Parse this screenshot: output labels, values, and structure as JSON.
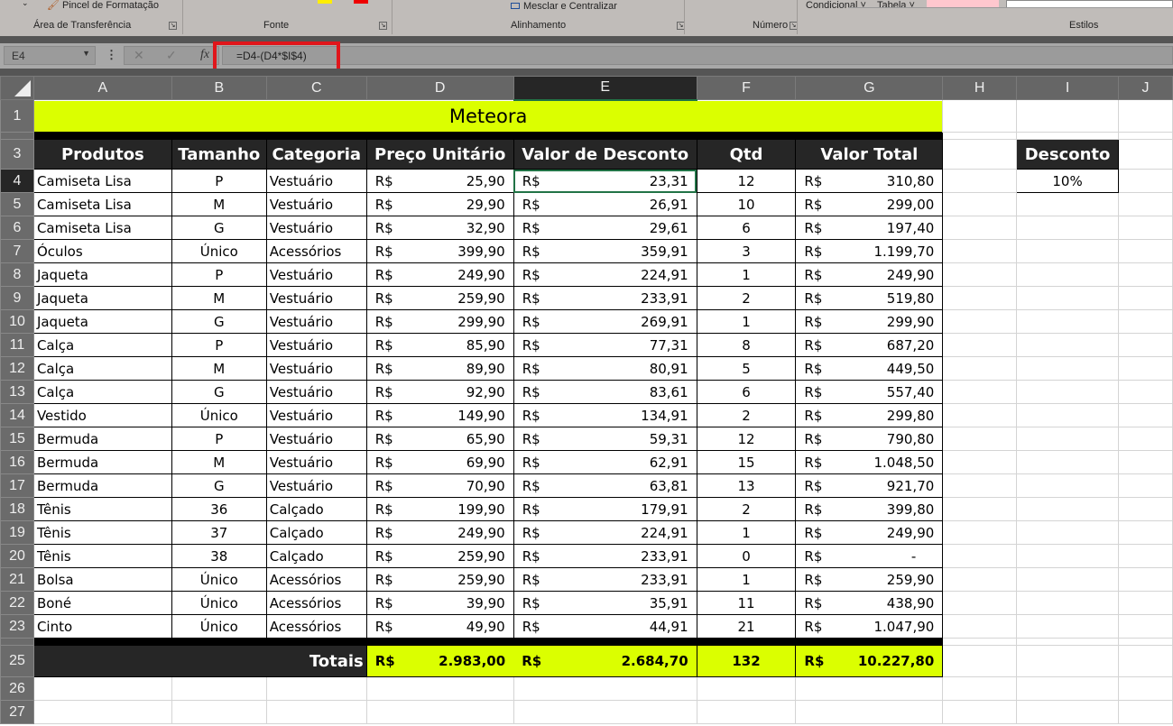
{
  "ribbon": {
    "clipboard_item": "Pincel de Formatação",
    "groups": [
      "Área de Transferência",
      "Fonte",
      "Alinhamento",
      "Número",
      "Estilos"
    ],
    "merge_label": "Mesclar e Centralizar",
    "conditional_label": "Condicional",
    "table_label": "Tabela"
  },
  "formula_bar": {
    "name_box": "E4",
    "formula": "=D4-(D4*$I$4)"
  },
  "columns": [
    "A",
    "B",
    "C",
    "D",
    "E",
    "F",
    "G",
    "H",
    "I",
    "J"
  ],
  "title": "Meteora",
  "headers": [
    "Produtos",
    "Tamanho",
    "Categoria",
    "Preço Unitário",
    "Valor de Desconto",
    "Qtd",
    "Valor Total"
  ],
  "currency": "R$",
  "rows": [
    [
      "Camiseta Lisa",
      "P",
      "Vestuário",
      "25,90",
      "23,31",
      "12",
      "310,80"
    ],
    [
      "Camiseta Lisa",
      "M",
      "Vestuário",
      "29,90",
      "26,91",
      "10",
      "299,00"
    ],
    [
      "Camiseta Lisa",
      "G",
      "Vestuário",
      "32,90",
      "29,61",
      "6",
      "197,40"
    ],
    [
      "Óculos",
      "Único",
      "Acessórios",
      "399,90",
      "359,91",
      "3",
      "1.199,70"
    ],
    [
      "Jaqueta",
      "P",
      "Vestuário",
      "249,90",
      "224,91",
      "1",
      "249,90"
    ],
    [
      "Jaqueta",
      "M",
      "Vestuário",
      "259,90",
      "233,91",
      "2",
      "519,80"
    ],
    [
      "Jaqueta",
      "G",
      "Vestuário",
      "299,90",
      "269,91",
      "1",
      "299,90"
    ],
    [
      "Calça",
      "P",
      "Vestuário",
      "85,90",
      "77,31",
      "8",
      "687,20"
    ],
    [
      "Calça",
      "M",
      "Vestuário",
      "89,90",
      "80,91",
      "5",
      "449,50"
    ],
    [
      "Calça",
      "G",
      "Vestuário",
      "92,90",
      "83,61",
      "6",
      "557,40"
    ],
    [
      "Vestido",
      "Único",
      "Vestuário",
      "149,90",
      "134,91",
      "2",
      "299,80"
    ],
    [
      "Bermuda",
      "P",
      "Vestuário",
      "65,90",
      "59,31",
      "12",
      "790,80"
    ],
    [
      "Bermuda",
      "M",
      "Vestuário",
      "69,90",
      "62,91",
      "15",
      "1.048,50"
    ],
    [
      "Bermuda",
      "G",
      "Vestuário",
      "70,90",
      "63,81",
      "13",
      "921,70"
    ],
    [
      "Tênis",
      "36",
      "Calçado",
      "199,90",
      "179,91",
      "2",
      "399,80"
    ],
    [
      "Tênis",
      "37",
      "Calçado",
      "249,90",
      "224,91",
      "1",
      "249,90"
    ],
    [
      "Tênis",
      "38",
      "Calçado",
      "259,90",
      "233,91",
      "0",
      "-"
    ],
    [
      "Bolsa",
      "Único",
      "Acessórios",
      "259,90",
      "233,91",
      "1",
      "259,90"
    ],
    [
      "Boné",
      "Único",
      "Acessórios",
      "39,90",
      "35,91",
      "11",
      "438,90"
    ],
    [
      "Cinto",
      "Único",
      "Acessórios",
      "49,90",
      "44,91",
      "21",
      "1.047,90"
    ]
  ],
  "totals": {
    "label": "Totais",
    "preco": "2.983,00",
    "desconto": "2.684,70",
    "qtd": "132",
    "total": "10.227,80"
  },
  "discount": {
    "label": "Desconto",
    "value": "10%"
  },
  "colors": {
    "accent": "#dbff00",
    "header_bg": "#262626",
    "selection": "#217346",
    "highlight": "#e0161b"
  }
}
